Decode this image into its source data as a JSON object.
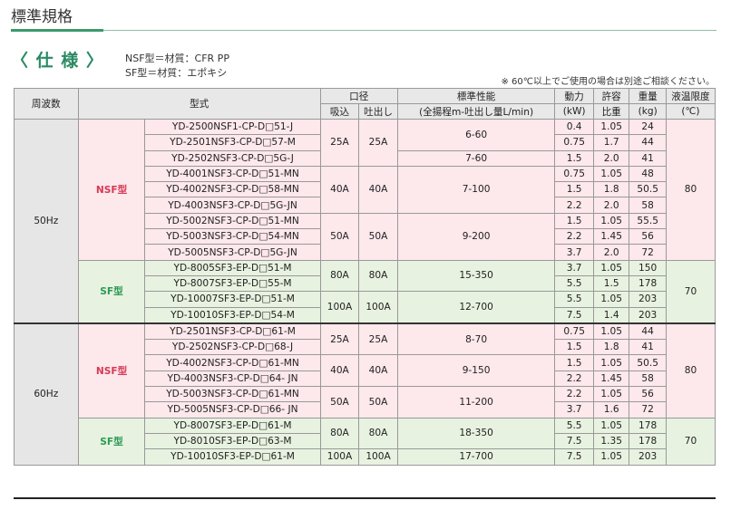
{
  "page_title": "標準規格",
  "spec_heading": "〈 仕 様 〉",
  "materials": [
    "NSF型＝材質：CFR PP",
    "SF型＝材質：エポキシ"
  ],
  "note": "※ 60℃以上でご使用の場合は別途ご相談ください。",
  "headers": {
    "freq": "周波数",
    "model": "型式",
    "bore": "口径",
    "suction": "吸込",
    "discharge": "吐出し",
    "perf": "標準性能",
    "perf_sub": "(全揚程m-吐出し量L/min)",
    "power": "動力",
    "power_unit": "(kW)",
    "allow": "許容",
    "allow_sub": "比重",
    "weight": "重量",
    "weight_unit": "(kg)",
    "temp": "液温限度",
    "temp_unit": "(℃)"
  },
  "sections": [
    {
      "freq": "50Hz",
      "groups": [
        {
          "type": "NSF型",
          "temp": "80",
          "bores": [
            {
              "suction": "25A",
              "discharge": "25A",
              "perfs": [
                {
                  "perf": "6-60",
                  "rows": [
                    {
                      "model": "YD-2500NSF1-CP-D□51-J",
                      "power": "0.4",
                      "sg": "1.05",
                      "weight": "24"
                    },
                    {
                      "model": "YD-2501NSF3-CP-D□57-M",
                      "power": "0.75",
                      "sg": "1.7",
                      "weight": "44"
                    }
                  ]
                },
                {
                  "perf": "7-60",
                  "rows": [
                    {
                      "model": "YD-2502NSF3-CP-D□5G-J",
                      "power": "1.5",
                      "sg": "2.0",
                      "weight": "41"
                    }
                  ]
                }
              ]
            },
            {
              "suction": "40A",
              "discharge": "40A",
              "perfs": [
                {
                  "perf": "7-100",
                  "rows": [
                    {
                      "model": "YD-4001NSF3-CP-D□51-MN",
                      "power": "0.75",
                      "sg": "1.05",
                      "weight": "48"
                    },
                    {
                      "model": "YD-4002NSF3-CP-D□58-MN",
                      "power": "1.5",
                      "sg": "1.8",
                      "weight": "50.5"
                    },
                    {
                      "model": "YD-4003NSF3-CP-D□5G-JN",
                      "power": "2.2",
                      "sg": "2.0",
                      "weight": "58"
                    }
                  ]
                }
              ]
            },
            {
              "suction": "50A",
              "discharge": "50A",
              "perfs": [
                {
                  "perf": "9-200",
                  "rows": [
                    {
                      "model": "YD-5002NSF3-CP-D□51-MN",
                      "power": "1.5",
                      "sg": "1.05",
                      "weight": "55.5"
                    },
                    {
                      "model": "YD-5003NSF3-CP-D□54-MN",
                      "power": "2.2",
                      "sg": "1.45",
                      "weight": "56"
                    },
                    {
                      "model": "YD-5005NSF3-CP-D□5G-JN",
                      "power": "3.7",
                      "sg": "2.0",
                      "weight": "72"
                    }
                  ]
                }
              ]
            }
          ]
        },
        {
          "type": "SF型",
          "temp": "70",
          "bores": [
            {
              "suction": "80A",
              "discharge": "80A",
              "perfs": [
                {
                  "perf": "15-350",
                  "rows": [
                    {
                      "model": "YD-8005SF3-EP-D□51-M",
                      "power": "3.7",
                      "sg": "1.05",
                      "weight": "150"
                    },
                    {
                      "model": "YD-8007SF3-EP-D□55-M",
                      "power": "5.5",
                      "sg": "1.5",
                      "weight": "178"
                    }
                  ]
                }
              ]
            },
            {
              "suction": "100A",
              "discharge": "100A",
              "perfs": [
                {
                  "perf": "12-700",
                  "rows": [
                    {
                      "model": "YD-10007SF3-EP-D□51-M",
                      "power": "5.5",
                      "sg": "1.05",
                      "weight": "203"
                    },
                    {
                      "model": "YD-10010SF3-EP-D□54-M",
                      "power": "7.5",
                      "sg": "1.4",
                      "weight": "203"
                    }
                  ]
                }
              ]
            }
          ]
        }
      ]
    },
    {
      "freq": "60Hz",
      "groups": [
        {
          "type": "NSF型",
          "temp": "80",
          "bores": [
            {
              "suction": "25A",
              "discharge": "25A",
              "perfs": [
                {
                  "perf": "8-70",
                  "rows": [
                    {
                      "model": "YD-2501NSF3-CP-D□61-M",
                      "power": "0.75",
                      "sg": "1.05",
                      "weight": "44"
                    },
                    {
                      "model": "YD-2502NSF3-CP-D□68-J",
                      "power": "1.5",
                      "sg": "1.8",
                      "weight": "41"
                    }
                  ]
                }
              ]
            },
            {
              "suction": "40A",
              "discharge": "40A",
              "perfs": [
                {
                  "perf": "9-150",
                  "rows": [
                    {
                      "model": "YD-4002NSF3-CP-D□61-MN",
                      "power": "1.5",
                      "sg": "1.05",
                      "weight": "50.5"
                    },
                    {
                      "model": "YD-4003NSF3-CP-D□64- JN",
                      "power": "2.2",
                      "sg": "1.45",
                      "weight": "58"
                    }
                  ]
                }
              ]
            },
            {
              "suction": "50A",
              "discharge": "50A",
              "perfs": [
                {
                  "perf": "11-200",
                  "rows": [
                    {
                      "model": "YD-5003NSF3-CP-D□61-MN",
                      "power": "2.2",
                      "sg": "1.05",
                      "weight": "56"
                    },
                    {
                      "model": "YD-5005NSF3-CP-D□66- JN",
                      "power": "3.7",
                      "sg": "1.6",
                      "weight": "72"
                    }
                  ]
                }
              ]
            }
          ]
        },
        {
          "type": "SF型",
          "temp": "70",
          "bores": [
            {
              "suction": "80A",
              "discharge": "80A",
              "perfs": [
                {
                  "perf": "18-350",
                  "rows": [
                    {
                      "model": "YD-8007SF3-EP-D□61-M",
                      "power": "5.5",
                      "sg": "1.05",
                      "weight": "178"
                    },
                    {
                      "model": "YD-8010SF3-EP-D□63-M",
                      "power": "7.5",
                      "sg": "1.35",
                      "weight": "178"
                    }
                  ]
                }
              ]
            },
            {
              "suction": "100A",
              "discharge": "100A",
              "perfs": [
                {
                  "perf": "17-700",
                  "rows": [
                    {
                      "model": "YD-10010SF3-EP-D□61-M",
                      "power": "7.5",
                      "sg": "1.05",
                      "weight": "203"
                    }
                  ]
                }
              ]
            }
          ]
        }
      ]
    }
  ]
}
